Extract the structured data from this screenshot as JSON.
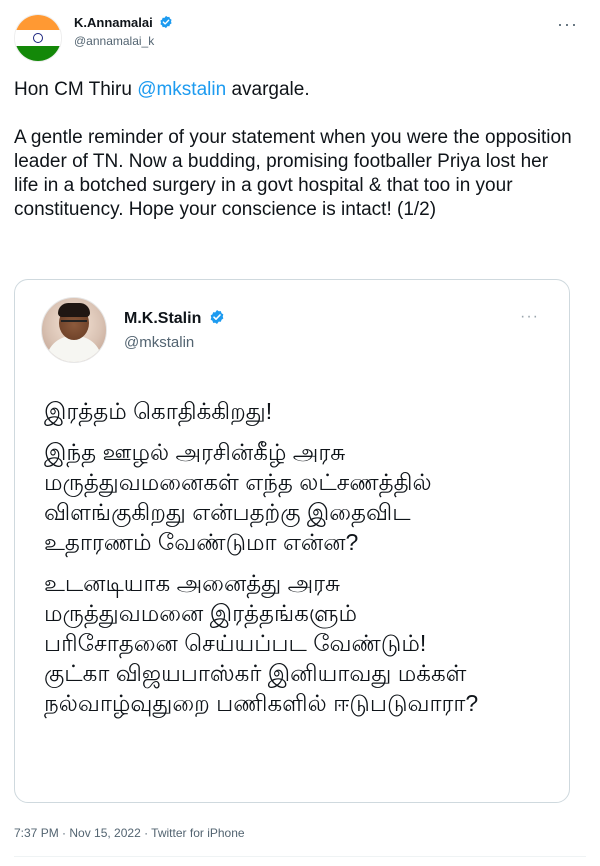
{
  "tweet": {
    "author_name": "K.Annamalai",
    "author_handle": "@annamalai_k",
    "more_icon": "more-horizontal-icon",
    "text_prefix": "Hon CM Thiru ",
    "mention": "@mkstalin",
    "text_suffix": " avargale.\n\nA gentle reminder of your statement when you were the opposition leader of TN. Now a budding, promising footballer Priya lost her life in a botched surgery in a govt hospital & that too in your constituency. Hope your conscience is intact! (1/2)",
    "meta": "7:37 PM · Nov 15, 2022 · Twitter for iPhone"
  },
  "quote": {
    "author_name": "M.K.Stalin",
    "author_handle": "@mkstalin",
    "paragraphs": [
      [
        "இரத்தம் கொதிக்கிறது!"
      ],
      [
        "இந்த ஊழல் அரசின்கீழ் அரசு",
        "மருத்துவமனைகள் எந்த லட்சணத்தில்",
        "விளங்குகிறது என்பதற்கு இதைவிட",
        "உதாரணம் வேண்டுமா என்ன?"
      ],
      [
        "உடனடியாக அனைத்து அரசு",
        "மருத்துவமனை இரத்தங்களும்",
        "பரிசோதனை செய்யப்பட வேண்டும்!",
        "குட்கா விஜயபாஸ்கர் இனியாவது மக்கள்",
        "நல்வாழ்வுதுறை பணிகளில் ஈடுபடுவாரா?"
      ]
    ]
  },
  "colors": {
    "verified": "#1d9bf0",
    "mention": "#1d9bf0",
    "flag_saffron": "#ff9933",
    "flag_green": "#138808"
  }
}
